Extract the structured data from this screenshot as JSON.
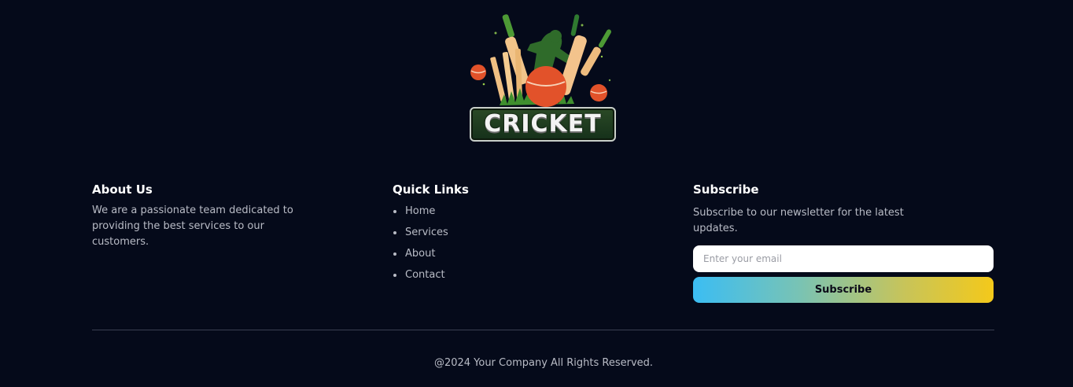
{
  "logo": {
    "word": "CRICKET",
    "icon": "cricket-logo-icon"
  },
  "about": {
    "title": "About Us",
    "text": "We are a passionate team dedicated to providing the best services to our customers."
  },
  "quick_links": {
    "title": "Quick Links",
    "items": [
      {
        "label": "Home"
      },
      {
        "label": "Services"
      },
      {
        "label": "About"
      },
      {
        "label": "Contact"
      }
    ]
  },
  "subscribe": {
    "title": "Subscribe",
    "text": "Subscribe to our newsletter for the latest updates.",
    "email_value": "",
    "email_placeholder": "Enter your email",
    "button_label": "Subscribe"
  },
  "copyright": "@2024 Your Company All Rights Reserved.",
  "colors": {
    "background": "#050a1a",
    "text_muted": "#b9bcc6",
    "button_gradient_start": "#3bbdf3",
    "button_gradient_end": "#f4c91a"
  }
}
